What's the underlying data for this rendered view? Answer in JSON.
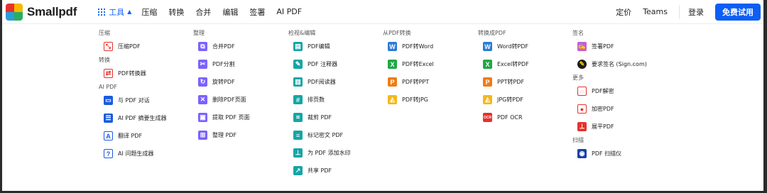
{
  "app": {
    "name": "Smallpdf"
  },
  "topnav": {
    "tools_label": "工具",
    "links": [
      "压缩",
      "转换",
      "合并",
      "编辑",
      "签署",
      "AI PDF"
    ],
    "pricing": "定价",
    "teams": "Teams",
    "login": "登录",
    "trial": "免费试用"
  },
  "colors": {
    "primary": "#0d5ef5",
    "nav_active": "#1565ff"
  },
  "menu": {
    "col1": {
      "sec_compress": "压缩",
      "compress_pdf": "压缩PDF",
      "sec_convert": "转换",
      "pdf_converter": "PDF转换器",
      "sec_ai": "AI PDF",
      "chat_pdf": "与 PDF 对话",
      "ai_summary": "AI PDF 摘要生成器",
      "translate_pdf": "翻译 PDF",
      "ai_questions": "AI 问题生成器"
    },
    "col2": {
      "sec_organize": "整理",
      "merge_pdf": "合并PDF",
      "split_pdf": "PDF分割",
      "rotate_pdf": "旋转PDF",
      "delete_pages": "删除PDF页面",
      "extract_pages": "提取 PDF 页面",
      "organize_pdf": "整理 PDF"
    },
    "col3": {
      "sec_view_edit": "检视&编辑",
      "edit_pdf": "PDF编辑",
      "annotate": "PDF 注释器",
      "reader": "PDF阅读器",
      "page_numbers": "排页数",
      "crop": "裁剪 PDF",
      "redact": "标记密文 PDF",
      "watermark": "为 PDF 添加水印",
      "share": "共享 PDF"
    },
    "col4": {
      "sec_from_pdf": "从PDF转换",
      "to_word": "PDF转Word",
      "to_excel": "PDF转Excel",
      "to_ppt": "PDF转PPT",
      "to_jpg": "PDF转JPG",
      "glyph_w": "W",
      "glyph_x": "X",
      "glyph_p": "P"
    },
    "col5": {
      "sec_to_pdf": "转换成PDF",
      "word_to": "Word转PDF",
      "excel_to": "Excel转PDF",
      "ppt_to": "PPT转PDF",
      "jpg_to": "JPG转PDF",
      "ocr": "PDF OCR",
      "glyph_w": "W",
      "glyph_x": "X",
      "glyph_p": "P",
      "glyph_ocr": "OCR"
    },
    "col6": {
      "sec_sign": "签名",
      "sign_pdf": "签署PDF",
      "request_sign": "要求签名 (Sign.com)",
      "sec_more": "更多",
      "unlock": "PDF解密",
      "protect": "加密PDF",
      "flatten": "展平PDF",
      "sec_scan": "扫描",
      "scanner": "PDF 扫描仪"
    }
  }
}
